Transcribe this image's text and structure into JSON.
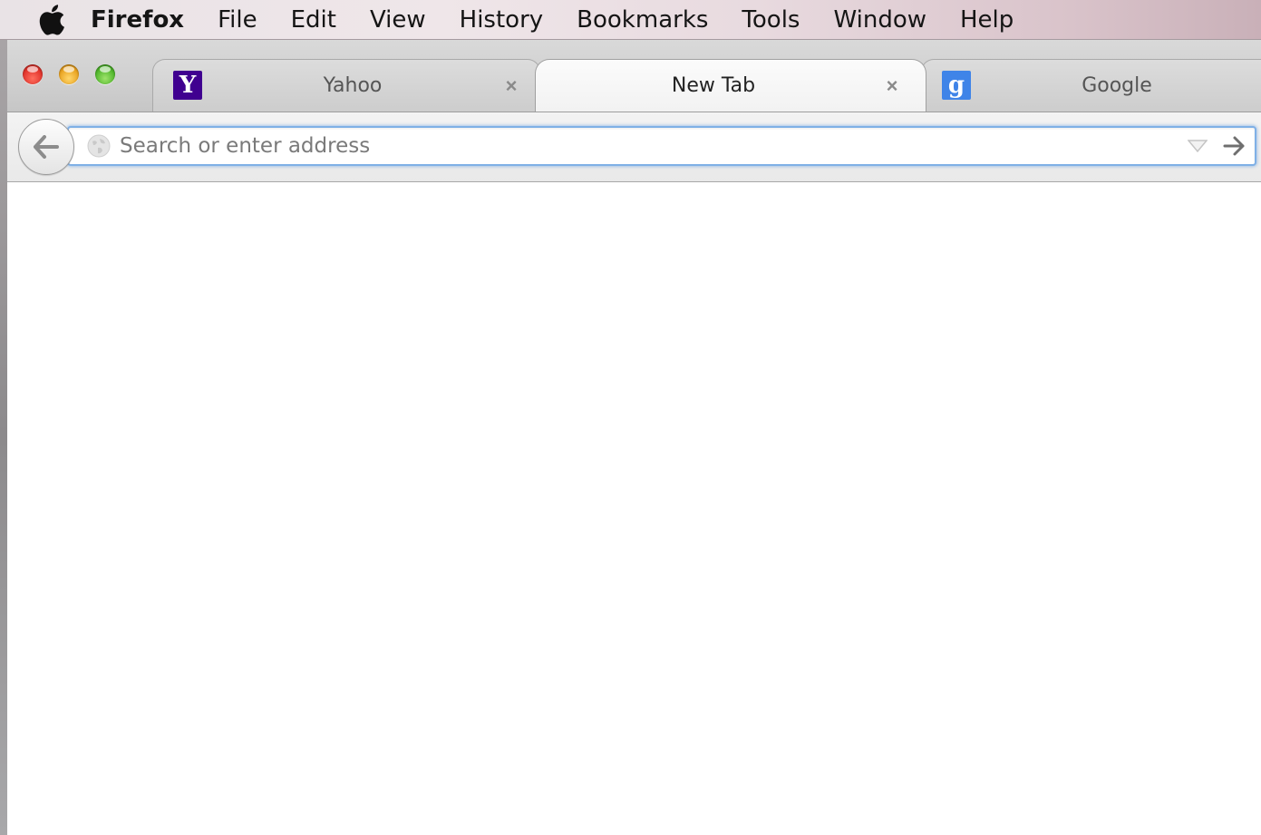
{
  "menubar": {
    "apple_icon": "apple-icon",
    "app_name": "Firefox",
    "items": [
      "File",
      "Edit",
      "View",
      "History",
      "Bookmarks",
      "Tools",
      "Window",
      "Help"
    ]
  },
  "tabs": [
    {
      "label": "Yahoo",
      "favicon": "Y",
      "favicon_color": "#400090",
      "active": false
    },
    {
      "label": "New Tab",
      "active": true
    },
    {
      "label": "Google",
      "favicon": "g",
      "favicon_color": "#3f84e8",
      "active": false
    }
  ],
  "navbar": {
    "url_value": "",
    "url_placeholder": "Search or enter address"
  },
  "colors": {
    "urlbar_focus": "#7fb0e6",
    "close": "#e0332b",
    "minimize": "#e9a21f",
    "maximize": "#4fb52b"
  }
}
